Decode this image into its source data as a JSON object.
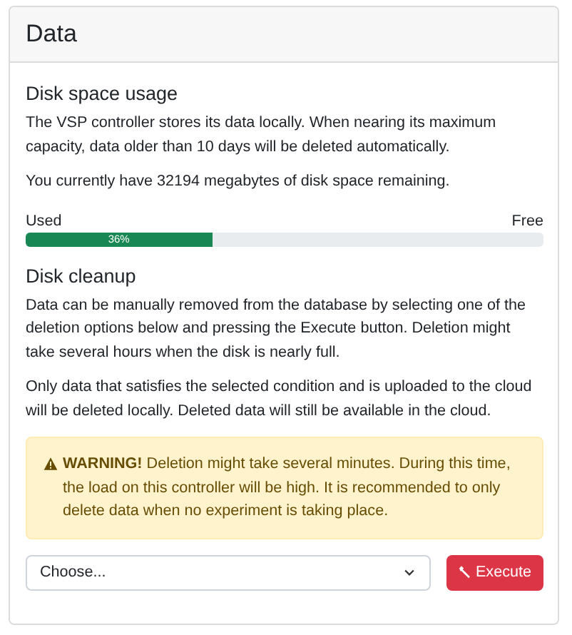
{
  "card": {
    "title": "Data"
  },
  "usage": {
    "heading": "Disk space usage",
    "paragraphs": [
      "The VSP controller stores its data locally. When nearing its maximum capacity, data older than 10 days will be deleted automatically.",
      "You currently have 32194 megabytes of disk space remaining."
    ],
    "used_label": "Used",
    "free_label": "Free",
    "level": 0.36,
    "reading": "36%"
  },
  "cleanup": {
    "heading": "Disk cleanup",
    "paragraphs": [
      "Data can be manually removed from the database by selecting one of the deletion options below and pressing the Execute button. Deletion might take several hours when the disk is nearly full.",
      "Only data that satisfies the selected condition and is uploaded to the cloud will be deleted locally. Deleted data will still be available in the cloud."
    ],
    "warning": "**WARNING!** Deletion might take several minutes. During this time, the load on this controller will be high. It is recommended to only delete data when no experiment is taking place.",
    "select": {
      "value": "Choose..."
    },
    "button": "Execute"
  }
}
